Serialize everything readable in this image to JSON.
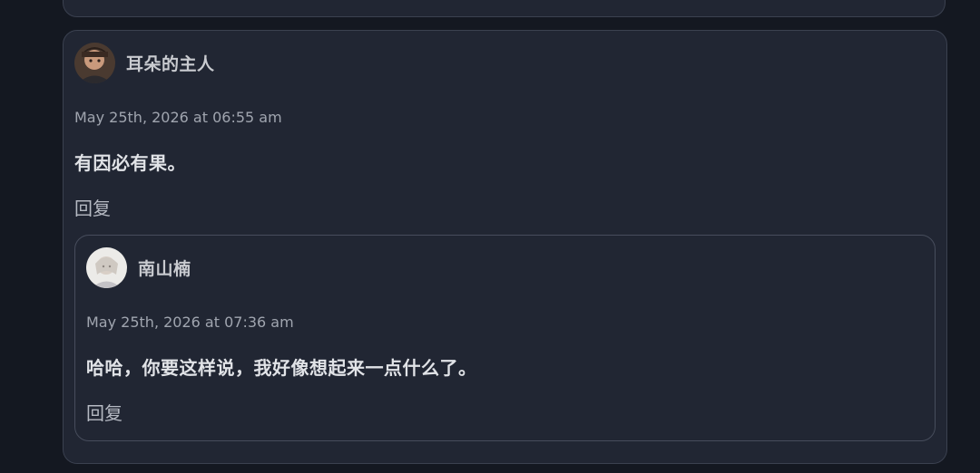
{
  "comments": [
    {
      "author": "耳朵的主人",
      "date": "May 25th, 2026 at 06:55 am",
      "content": "有因必有果。",
      "reply_label": "回复",
      "replies": [
        {
          "author": "南山楠",
          "date": "May 25th, 2026 at 07:36 am",
          "content": "哈哈，你要这样说，我好像想起来一点什么了。",
          "reply_label": "回复"
        }
      ]
    }
  ],
  "colors": {
    "page_background": "#141821",
    "card_background": "#212633",
    "card_border": "#3b4150",
    "text_primary": "#e1e3e7",
    "text_muted": "#a0a5af"
  }
}
